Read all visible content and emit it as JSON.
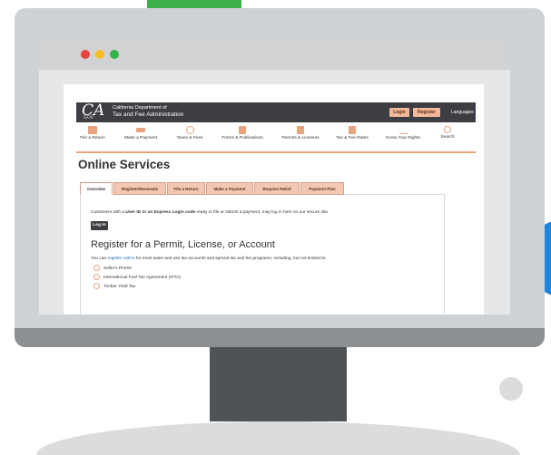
{
  "colors": {
    "accent": "#e8a27e",
    "header_bg": "#3c3e44",
    "traffic_red": "#e8433a",
    "traffic_yellow": "#f5be1d",
    "traffic_green": "#32b34a",
    "decor_green": "#3eb24a",
    "decor_blue": "#1f86e0"
  },
  "site": {
    "logo": {
      "letter": "CA",
      "sub": "GOV"
    },
    "agency_line1": "California Department of",
    "agency_line2": "Tax and Fee Administration",
    "login_label": "Login",
    "register_label": "Register",
    "languages_label": "Languages"
  },
  "nav": {
    "items": [
      {
        "label": "File a Return",
        "icon": "file-icon"
      },
      {
        "label": "Make a Payment",
        "icon": "payment-icon"
      },
      {
        "label": "Taxes & Fees",
        "icon": "chart-icon"
      },
      {
        "label": "Forms & Publications",
        "icon": "forms-icon"
      },
      {
        "label": "Permits & Licenses",
        "icon": "permit-icon"
      },
      {
        "label": "Tax & Fee Rates",
        "icon": "rates-icon"
      },
      {
        "label": "Know Your Rights",
        "icon": "scales-icon"
      },
      {
        "label": "Search",
        "icon": "search-icon"
      }
    ]
  },
  "page": {
    "title": "Online Services",
    "tabs": [
      {
        "label": "Overview",
        "active": true
      },
      {
        "label": "Register/Renewals",
        "active": false
      },
      {
        "label": "File a Return",
        "active": false
      },
      {
        "label": "Make a Payment",
        "active": false
      },
      {
        "label": "Request Relief",
        "active": false
      },
      {
        "label": "Payment Plan",
        "active": false
      }
    ],
    "intro_prefix": "Customers with a ",
    "intro_bold": "User ID or an Express Login code",
    "intro_suffix": " ready to file or submit a payment, may log in here on our secure site.",
    "login_button": "Log In",
    "register_heading": "Register for a Permit, License, or Account",
    "register_intro_prefix": "You can ",
    "register_intro_link": "register online",
    "register_intro_suffix": " for most sales and use tax accounts and special tax and fee programs, including, but not limited to:",
    "options": [
      "Seller's Permit",
      "International Fuel Tax Agreement (IFTA)",
      "Timber Yield Tax"
    ]
  }
}
